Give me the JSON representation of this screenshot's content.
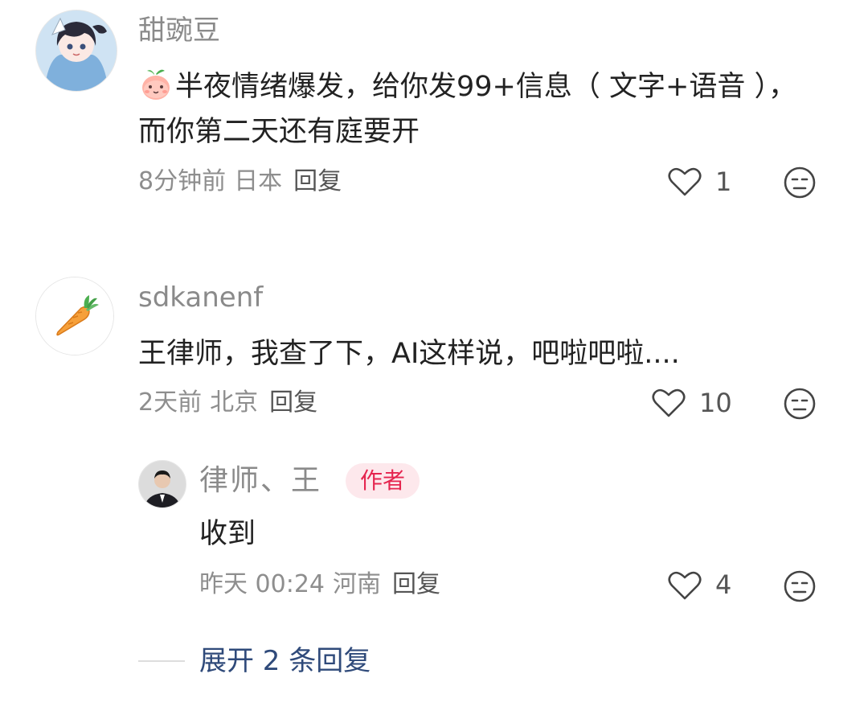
{
  "comments": [
    {
      "username": "甜豌豆",
      "emoji_icon": "peach-face-icon",
      "text": "半夜情绪爆发，给你发99+信息（ 文字+语音 ），而你第二天还有庭要开",
      "time": "8分钟前",
      "location": "日本",
      "reply_label": "回复",
      "likes": "1"
    },
    {
      "username": "sdkanenf",
      "text": "王律师，我查了下，AI这样说，吧啦吧啦....",
      "time": "2天前",
      "location": "北京",
      "reply_label": "回复",
      "likes": "10",
      "replies": [
        {
          "username": "律师、王",
          "badge": "作者",
          "text": "收到",
          "time": "昨天 00:24",
          "location": "河南",
          "reply_label": "回复",
          "likes": "4"
        }
      ],
      "expand_label": "展开 2 条回复"
    }
  ],
  "colors": {
    "badge_bg": "#fde8ec",
    "badge_text": "#e5254f",
    "expand_link": "#2f4a7a"
  }
}
